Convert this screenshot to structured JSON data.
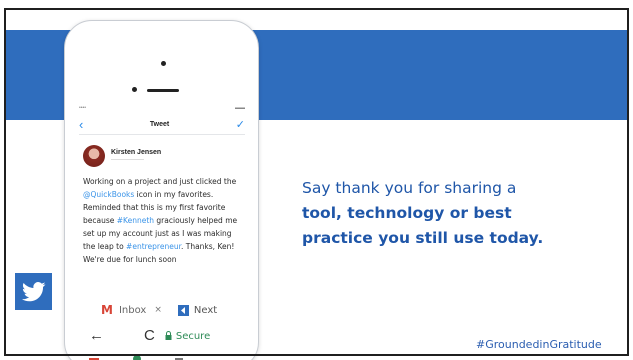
{
  "slide": {
    "headline_line1": "Say thank you for sharing a",
    "headline_line2": "tool, technology or best",
    "headline_line3": "practice you still use today.",
    "hashtag": "#GroundedinGratitude",
    "accent_color": "#2f6dbd",
    "text_color": "#1f56a8"
  },
  "phone": {
    "nav": {
      "title": "Tweet",
      "back_icon": "chevron-left-icon",
      "compose_icon": "compose-icon"
    },
    "tweet": {
      "author_name": "Kirsten Jensen",
      "body_segments": [
        "Working on a project and just clicked the ",
        "@QuickBooks",
        " icon in my favorites. Reminded that this is my first favorite because ",
        "#Kenneth",
        " graciously helped me set up my account just as I was making the leap to ",
        "#entrepreneur",
        ". Thanks, Ken! We're due for lunch soon"
      ]
    },
    "tabs": {
      "inbox_label": "Inbox",
      "close_label": "×",
      "next_label": "Next"
    },
    "browser": {
      "back_icon": "←",
      "reload_icon": "C",
      "secure_label": "Secure"
    }
  },
  "icons": {
    "twitter_badge": "twitter-bird-icon"
  }
}
